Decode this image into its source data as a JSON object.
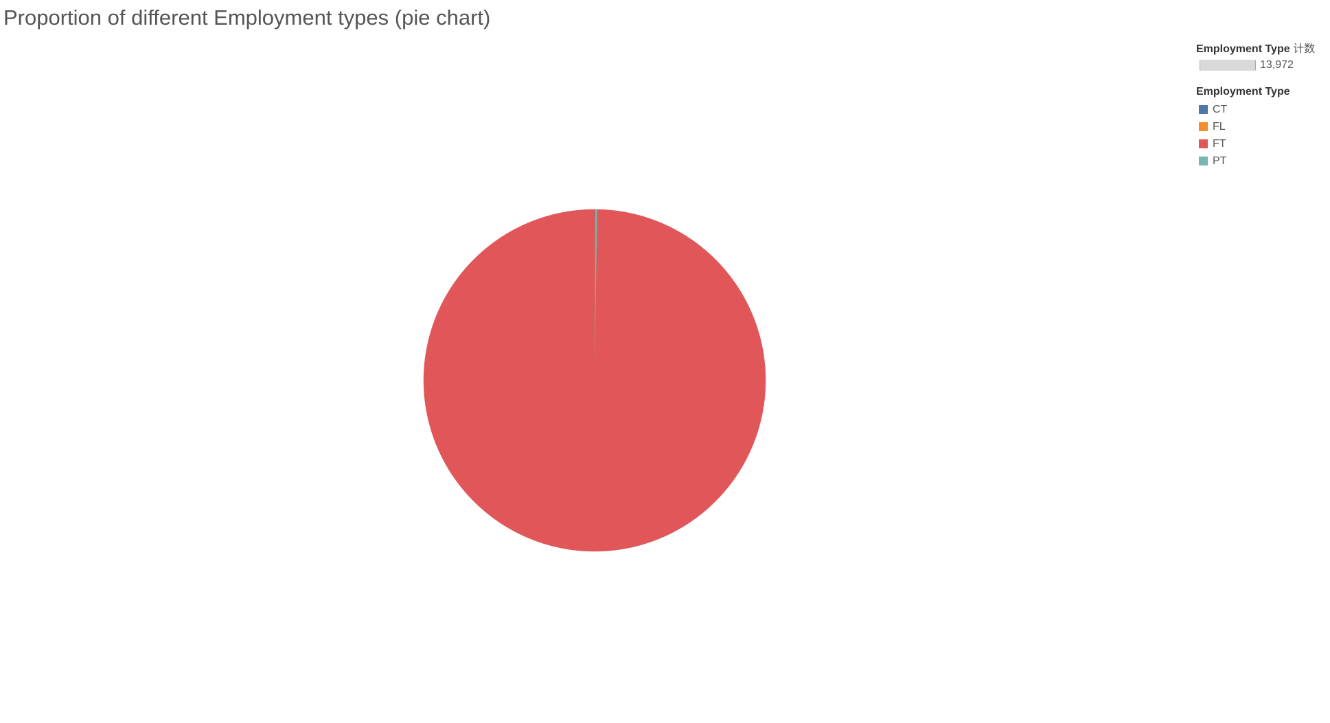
{
  "chart_data": {
    "type": "pie",
    "title": "Proportion of different Employment types (pie chart)",
    "size_legend": {
      "title": "Employment Type",
      "title_suffix": "计数",
      "value": "13,972"
    },
    "color_legend_title": "Employment Type",
    "start_angle_deg": 0,
    "direction": "clockwise",
    "slices": [
      {
        "label": "CT",
        "value": 10,
        "color": "#4e79a7"
      },
      {
        "label": "FL",
        "value": 10,
        "color": "#f28e2b"
      },
      {
        "label": "PT",
        "value": 16,
        "color": "#76b7b2"
      },
      {
        "label": "FT",
        "value": 13936,
        "color": "#e15759"
      }
    ],
    "legend_order": [
      "CT",
      "FL",
      "FT",
      "PT"
    ],
    "legend_position": "top-right"
  }
}
